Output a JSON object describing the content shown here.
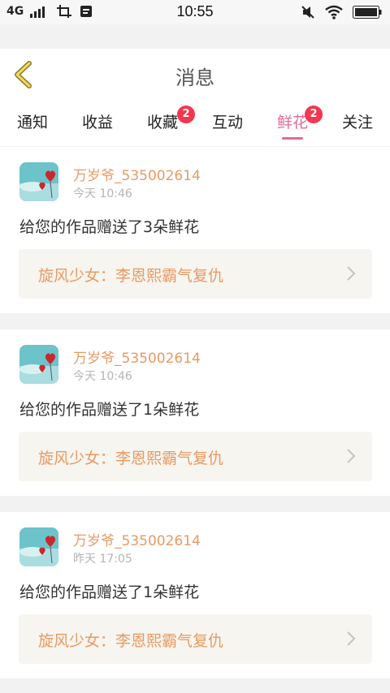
{
  "status_bar": {
    "network": "4G",
    "time": "10:55"
  },
  "header": {
    "title": "消息"
  },
  "tabs": [
    {
      "label": "通知",
      "badge": ""
    },
    {
      "label": "收益",
      "badge": ""
    },
    {
      "label": "收藏",
      "badge": "2"
    },
    {
      "label": "互动",
      "badge": ""
    },
    {
      "label": "鲜花",
      "badge": "2",
      "active": true
    },
    {
      "label": "关注",
      "badge": ""
    }
  ],
  "messages": [
    {
      "username": "万岁爷_535002614",
      "time": "今天 10:46",
      "text_prefix": "给您的作品赠送了",
      "count": "3",
      "text_suffix": "朵鲜花",
      "work_title": "旋风少女：李恩熙霸气复仇"
    },
    {
      "username": "万岁爷_535002614",
      "time": "今天 10:46",
      "text_prefix": "给您的作品赠送了",
      "count": "1",
      "text_suffix": "朵鲜花",
      "work_title": "旋风少女：李恩熙霸气复仇"
    },
    {
      "username": "万岁爷_535002614",
      "time": "昨天 17:05",
      "text_prefix": "给您的作品赠送了",
      "count": "1",
      "text_suffix": "朵鲜花",
      "work_title": "旋风少女：李恩熙霸气复仇"
    }
  ],
  "colors": {
    "accent_pink": "#e36a93",
    "username_orange": "#e89a63",
    "badge_red": "#f4364f",
    "work_bg": "#f6f5ef"
  }
}
